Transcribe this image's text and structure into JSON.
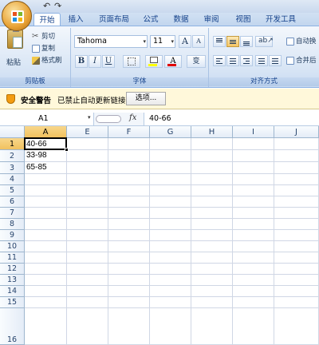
{
  "qat": {
    "undo": "↶",
    "redo": "↷"
  },
  "tabs": [
    "开始",
    "插入",
    "页面布局",
    "公式",
    "数据",
    "审阅",
    "视图",
    "开发工具"
  ],
  "ribbon": {
    "clipboard": {
      "paste": "粘贴",
      "cut": "剪切",
      "copy": "复制",
      "format_painter": "格式刷",
      "label": "剪贴板"
    },
    "font": {
      "name": "Tahoma",
      "size": "11",
      "bold": "B",
      "italic": "I",
      "underline": "U",
      "grow": "A",
      "shrink": "A",
      "fill_color_icon": "fill-color-icon",
      "font_color_letter": "A",
      "phonetic": "变",
      "label": "字体"
    },
    "alignment": {
      "wrap_text": "自动换",
      "merge": "合并后",
      "label": "对齐方式"
    }
  },
  "security": {
    "title": "安全警告",
    "message": "已禁止自动更新链接",
    "options_button": "选项..."
  },
  "formula_bar": {
    "name_box": "A1",
    "fx": "fx",
    "value": "40-66"
  },
  "grid": {
    "columns": [
      "A",
      "E",
      "F",
      "G",
      "H",
      "I",
      "J"
    ],
    "rows": [
      "1",
      "2",
      "3",
      "4",
      "5",
      "6",
      "7",
      "8",
      "9",
      "10",
      "11",
      "12",
      "13",
      "14",
      "15",
      "16"
    ],
    "cells_a": [
      "40-66",
      "33-98",
      "65-85"
    ]
  },
  "colors": {
    "accent": "#15428b",
    "selected_header": "#f1c15f",
    "warning_bg": "#fff8da"
  }
}
